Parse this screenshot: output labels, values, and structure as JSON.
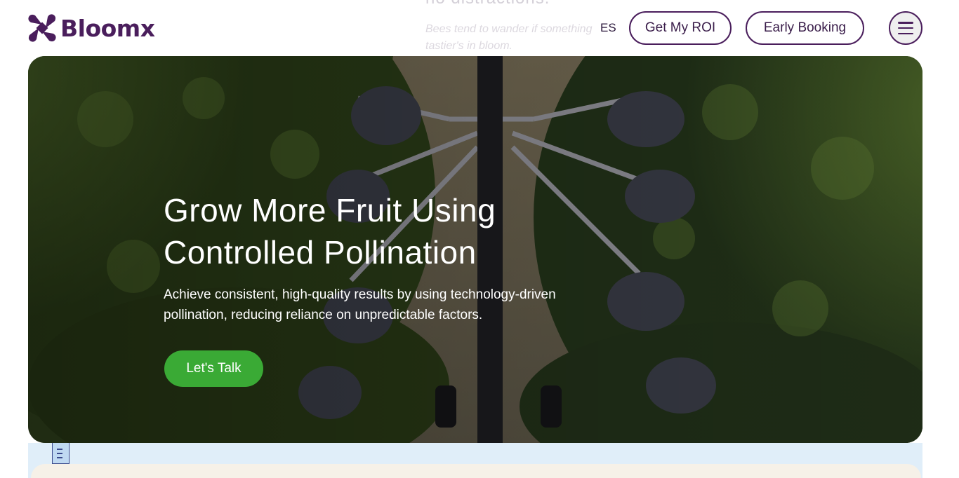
{
  "background_text": {
    "heading": "no distractions.",
    "subtext": "Bees tend to wander if something tastier's in bloom."
  },
  "header": {
    "logo_text": "Bloomx",
    "language": "ES",
    "roi_label": "Get My ROI",
    "early_booking_label": "Early Booking",
    "menu_icon": "hamburger-menu-icon"
  },
  "hero": {
    "title": "Grow More Fruit Using Controlled Pollination",
    "description": "Achieve consistent, high-quality results by using technology-driven pollination, reducing reliance on unpredictable factors.",
    "cta_label": "Let's Talk",
    "background": "aerial photo of a pollination machine between orchard tree rows"
  },
  "colors": {
    "brand_purple": "#4a1e5c",
    "cta_green": "#3aaa35",
    "lower_band": "#e0eef9",
    "card_cream": "#f6f1e8"
  }
}
